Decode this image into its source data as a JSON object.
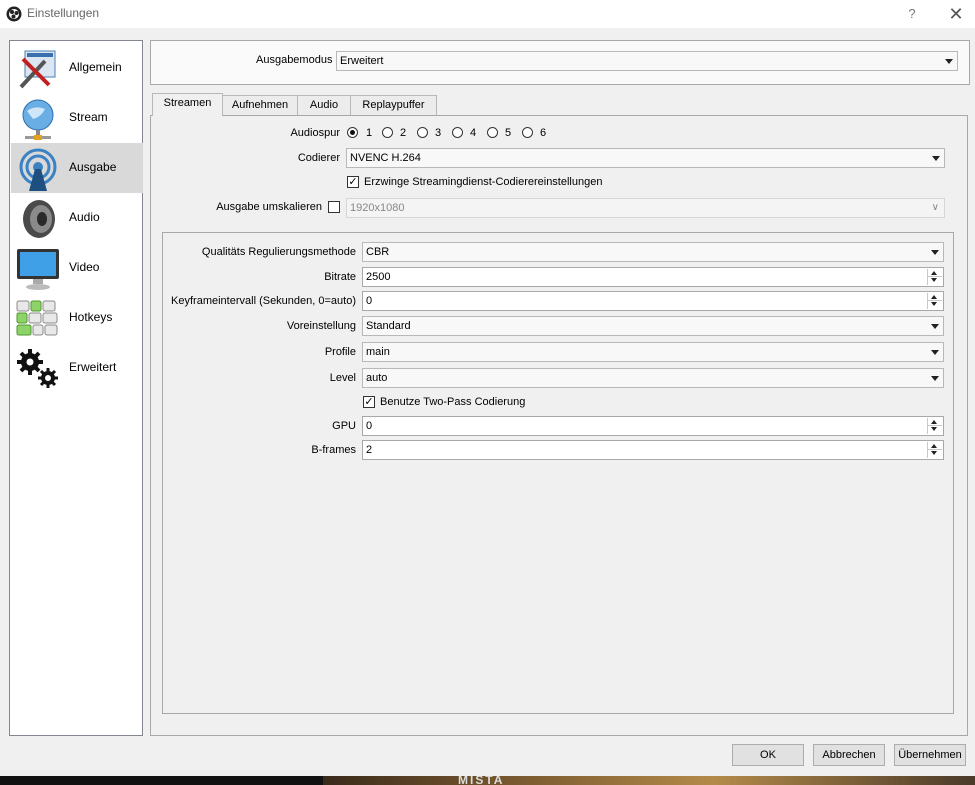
{
  "window": {
    "title": "Einstellungen",
    "help": "?",
    "close": "✕"
  },
  "sidebar": {
    "items": [
      {
        "label": "Allgemein",
        "icon": "wrench-screwdriver-icon"
      },
      {
        "label": "Stream",
        "icon": "globe-network-icon"
      },
      {
        "label": "Ausgabe",
        "icon": "broadcast-signal-icon",
        "selected": true
      },
      {
        "label": "Audio",
        "icon": "speaker-icon"
      },
      {
        "label": "Video",
        "icon": "monitor-icon"
      },
      {
        "label": "Hotkeys",
        "icon": "keyboard-icon"
      },
      {
        "label": "Erweitert",
        "icon": "gears-icon"
      }
    ]
  },
  "output_mode": {
    "label": "Ausgabemodus",
    "value": "Erweitert"
  },
  "tabs": [
    {
      "label": "Streamen",
      "active": true
    },
    {
      "label": "Aufnehmen"
    },
    {
      "label": "Audio"
    },
    {
      "label": "Replaypuffer"
    }
  ],
  "streaming": {
    "audio_track": {
      "label": "Audiospur",
      "options": [
        "1",
        "2",
        "3",
        "4",
        "5",
        "6"
      ],
      "selected": "1"
    },
    "encoder": {
      "label": "Codierer",
      "value": "NVENC H.264"
    },
    "enforce": {
      "label": "Erzwinge Streamingdienst-Codierereinstellungen",
      "checked": true
    },
    "rescale": {
      "label": "Ausgabe umskalieren",
      "checked": false,
      "value": "1920x1080"
    }
  },
  "encoder_settings": {
    "rate_control": {
      "label": "Qualitäts Regulierungsmethode",
      "value": "CBR"
    },
    "bitrate": {
      "label": "Bitrate",
      "value": "2500"
    },
    "keyframe": {
      "label": "Keyframeintervall (Sekunden, 0=auto)",
      "value": "0"
    },
    "preset": {
      "label": "Voreinstellung",
      "value": "Standard"
    },
    "profile": {
      "label": "Profile",
      "value": "main"
    },
    "level": {
      "label": "Level",
      "value": "auto"
    },
    "two_pass": {
      "label": "Benutze Two-Pass Codierung",
      "checked": true
    },
    "gpu": {
      "label": "GPU",
      "value": "0"
    },
    "bframes": {
      "label": "B-frames",
      "value": "2"
    }
  },
  "buttons": {
    "ok": "OK",
    "cancel": "Abbrechen",
    "apply": "Übernehmen"
  },
  "background": {
    "text": "MISTA"
  }
}
